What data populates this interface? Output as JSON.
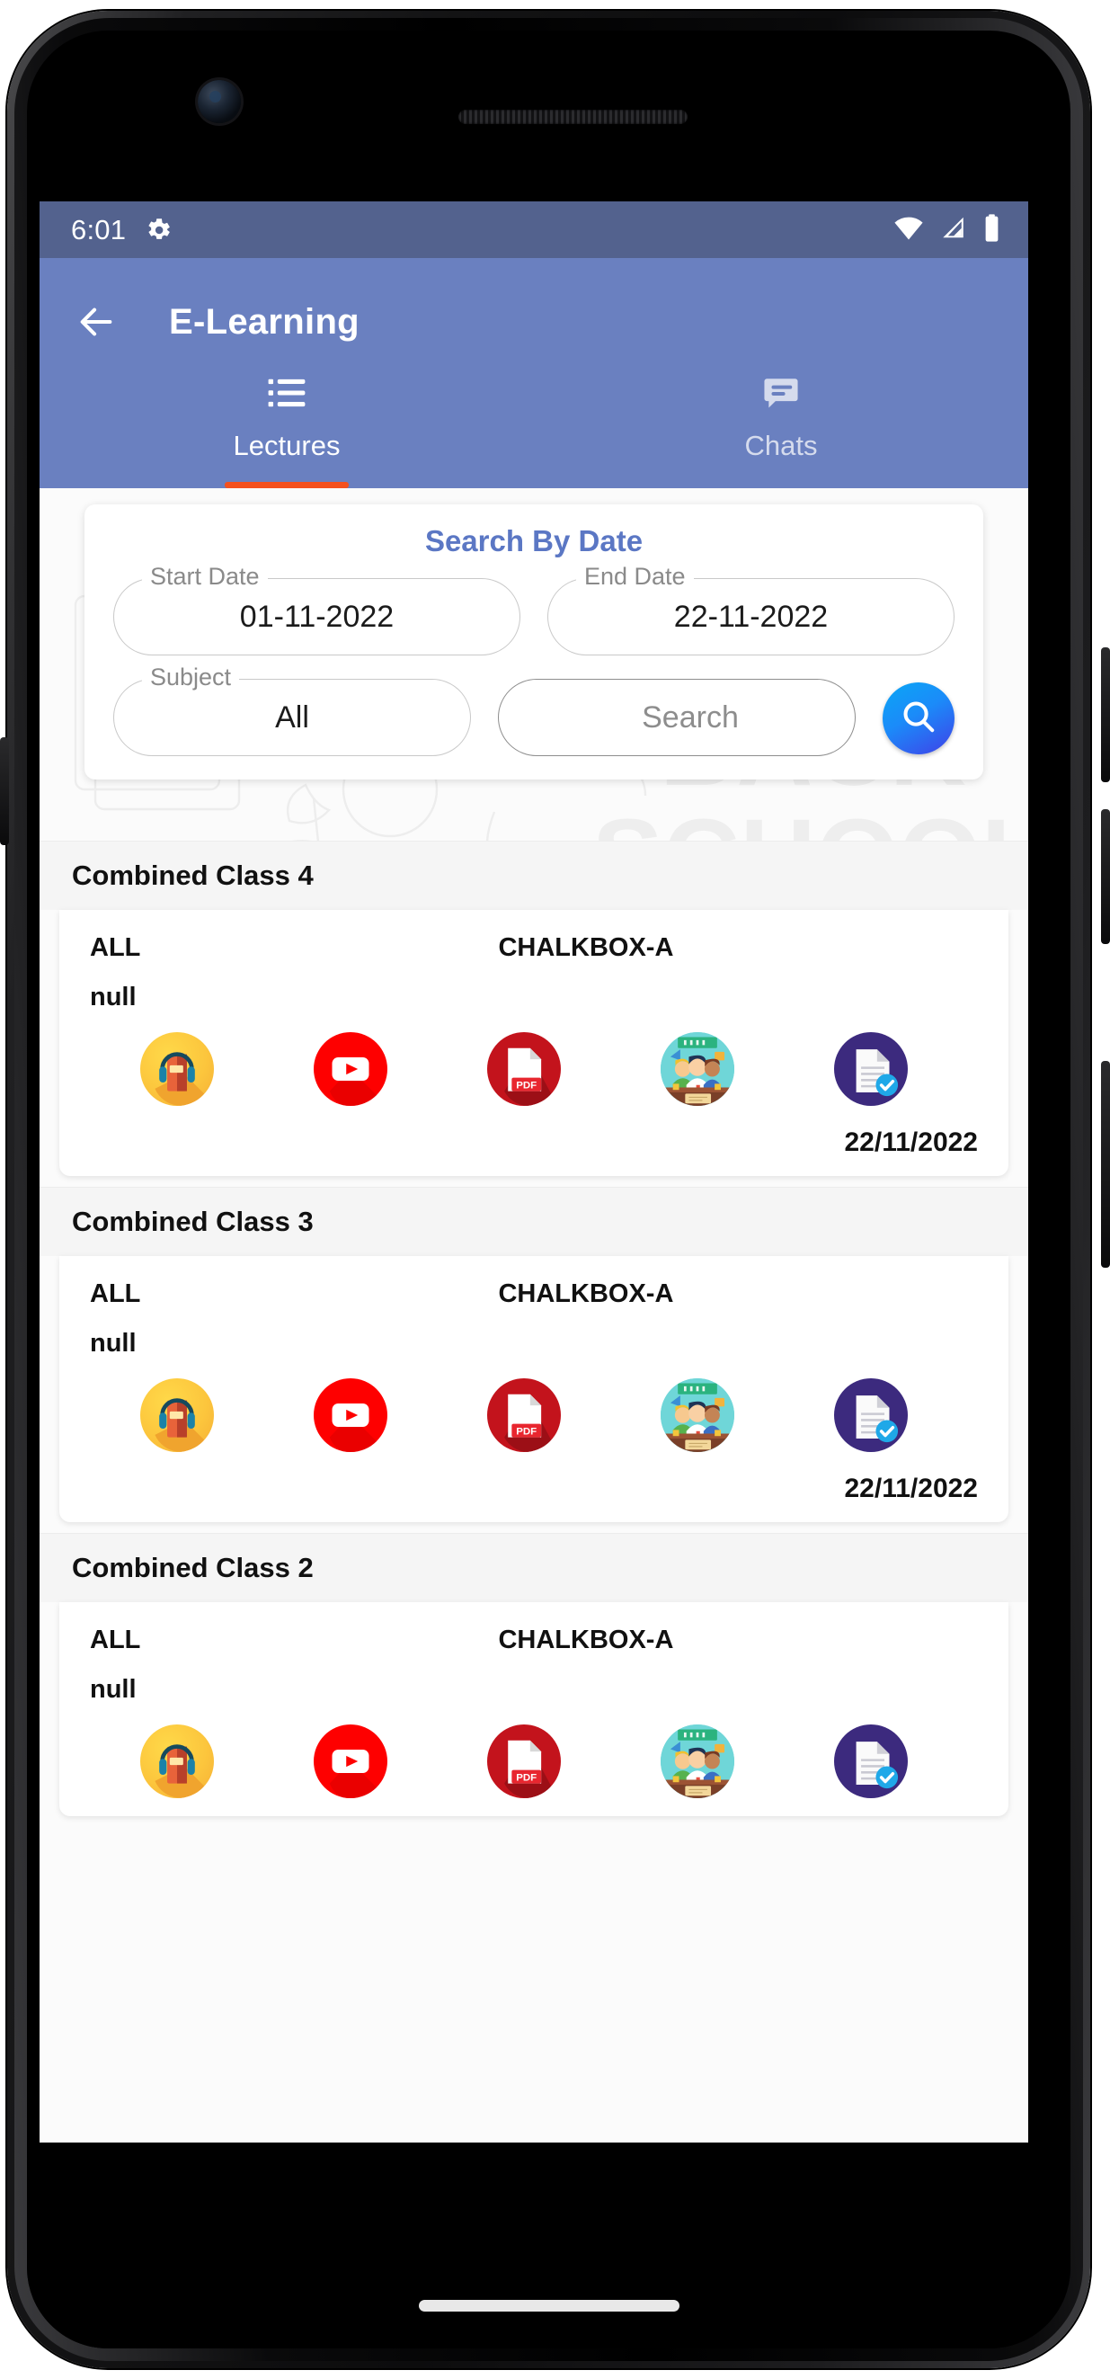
{
  "status_bar": {
    "time": "6:01",
    "icons": [
      "gear-icon",
      "wifi-icon",
      "cellular-signal-icon",
      "battery-icon"
    ]
  },
  "app_bar": {
    "back_icon": "back-arrow-icon",
    "title": "E-Learning"
  },
  "tabs": [
    {
      "label": "Lectures",
      "icon": "list-icon",
      "active": true
    },
    {
      "label": "Chats",
      "icon": "chat-bubble-icon",
      "active": false
    }
  ],
  "search_card": {
    "title": "Search By Date",
    "start_date": {
      "label": "Start Date",
      "value": "01-11-2022"
    },
    "end_date": {
      "label": "End Date",
      "value": "22-11-2022"
    },
    "subject": {
      "label": "Subject",
      "value": "All"
    },
    "search_text": {
      "placeholder": "Search",
      "value": ""
    },
    "search_button_icon": "search-icon"
  },
  "lectures": [
    {
      "header": "Combined Class 4",
      "subject": "ALL",
      "batch": "CHALKBOX-A",
      "description": "null",
      "date": "22/11/2022",
      "icons": [
        "audiobook-icon",
        "youtube-icon",
        "pdf-icon",
        "classroom-icon",
        "assignment-icon"
      ]
    },
    {
      "header": "Combined Class 3",
      "subject": "ALL",
      "batch": "CHALKBOX-A",
      "description": "null",
      "date": "22/11/2022",
      "icons": [
        "audiobook-icon",
        "youtube-icon",
        "pdf-icon",
        "classroom-icon",
        "assignment-icon"
      ]
    },
    {
      "header": "Combined Class 2",
      "subject": "ALL",
      "batch": "CHALKBOX-A",
      "description": "null",
      "date": "",
      "icons": [
        "audiobook-icon",
        "youtube-icon",
        "pdf-icon",
        "classroom-icon",
        "assignment-icon"
      ]
    }
  ],
  "colors": {
    "status_bar": "#53628e",
    "app_bar": "#6a80c0",
    "tab_indicator": "#f4511e",
    "card_title": "#5b77c4",
    "search_button": "#1b8bf9"
  },
  "background_watermark": "back-to-school-doodles"
}
